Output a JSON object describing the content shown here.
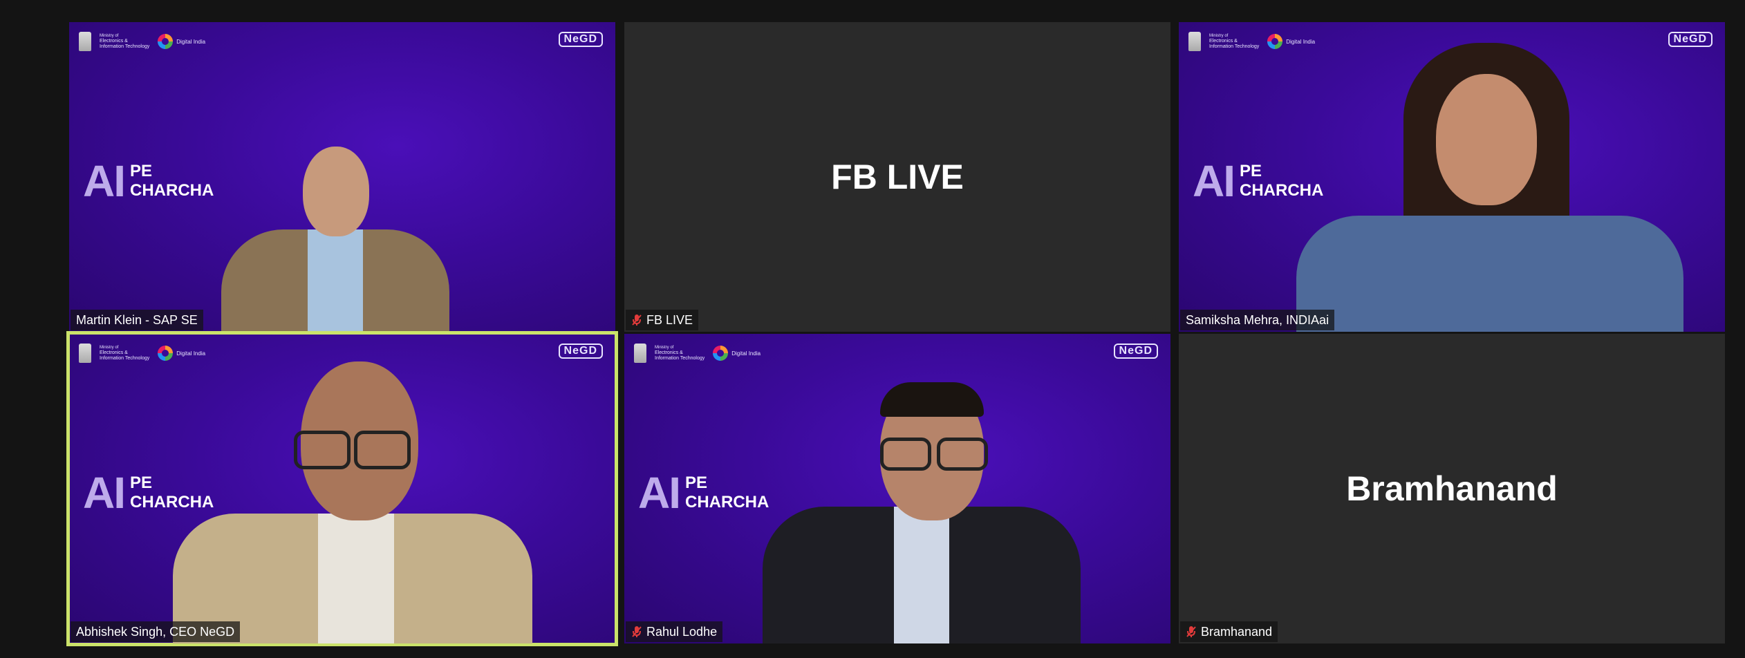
{
  "tiles": [
    {
      "name": "Martin Klein - SAP SE",
      "type": "video",
      "mic_off": false
    },
    {
      "name": "FB LIVE",
      "type": "name-card",
      "mic_off": true,
      "center_label": "FB LIVE"
    },
    {
      "name": "Samiksha Mehra, INDIAai",
      "type": "video",
      "mic_off": false
    },
    {
      "name": "Abhishek Singh, CEO NeGD",
      "type": "video",
      "mic_off": false,
      "active_speaker": true
    },
    {
      "name": "Rahul Lodhe",
      "type": "video",
      "mic_off": true
    },
    {
      "name": "Bramhanand",
      "type": "name-card",
      "mic_off": true,
      "center_label": "Bramhanand"
    }
  ],
  "branding": {
    "ai": "AI",
    "pe": "PE",
    "charcha": "CHARCHA",
    "negd": "NeGD",
    "ministry_line1": "Ministry of",
    "ministry_line2": "Electronics &",
    "ministry_line3": "Information Technology",
    "digital_india": "Digital India"
  },
  "colors": {
    "background": "#141414",
    "video_bg": "#3a0a98",
    "blank_tile": "#2a2a2a",
    "active_border": "#cbe36a",
    "mic_off": "#e23b3b"
  }
}
